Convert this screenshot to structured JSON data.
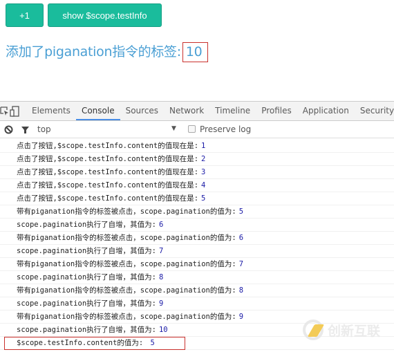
{
  "page": {
    "buttons": {
      "plus_label": "+1",
      "show_label": "show $scope.testInfo"
    },
    "heading": {
      "label": "添加了piganation指令的标签:",
      "value": "10"
    }
  },
  "devtools": {
    "tabs": [
      "Elements",
      "Console",
      "Sources",
      "Network",
      "Timeline",
      "Profiles",
      "Application",
      "Security"
    ],
    "active_tab": "Console",
    "filter": {
      "context": "top",
      "preserve_log_label": "Preserve log",
      "preserve_log_checked": false
    },
    "console": [
      {
        "text": "点击了按钮,$scope.testInfo.content的值现在是:",
        "value": "1"
      },
      {
        "text": "点击了按钮,$scope.testInfo.content的值现在是:",
        "value": "2"
      },
      {
        "text": "点击了按钮,$scope.testInfo.content的值现在是:",
        "value": "3"
      },
      {
        "text": "点击了按钮,$scope.testInfo.content的值现在是:",
        "value": "4"
      },
      {
        "text": "点击了按钮,$scope.testInfo.content的值现在是:",
        "value": "5"
      },
      {
        "text": "带有piganation指令的标签被点击，scope.pagination的值为:",
        "value": "5"
      },
      {
        "text": "scope.pagination执行了自增，其值为:",
        "value": "6"
      },
      {
        "text": "带有piganation指令的标签被点击，scope.pagination的值为:",
        "value": "6"
      },
      {
        "text": "scope.pagination执行了自增，其值为:",
        "value": "7"
      },
      {
        "text": "带有piganation指令的标签被点击，scope.pagination的值为:",
        "value": "7"
      },
      {
        "text": "scope.pagination执行了自增，其值为:",
        "value": "8"
      },
      {
        "text": "带有piganation指令的标签被点击，scope.pagination的值为:",
        "value": "8"
      },
      {
        "text": "scope.pagination执行了自增，其值为:",
        "value": "9"
      },
      {
        "text": "带有piganation指令的标签被点击，scope.pagination的值为:",
        "value": "9"
      },
      {
        "text": "scope.pagination执行了自增，其值为:",
        "value": "10"
      },
      {
        "text": "$scope.testInfo.content的值为:",
        "value": " 5",
        "highlighted": true
      }
    ]
  },
  "watermark": {
    "text": "创新互联"
  }
}
